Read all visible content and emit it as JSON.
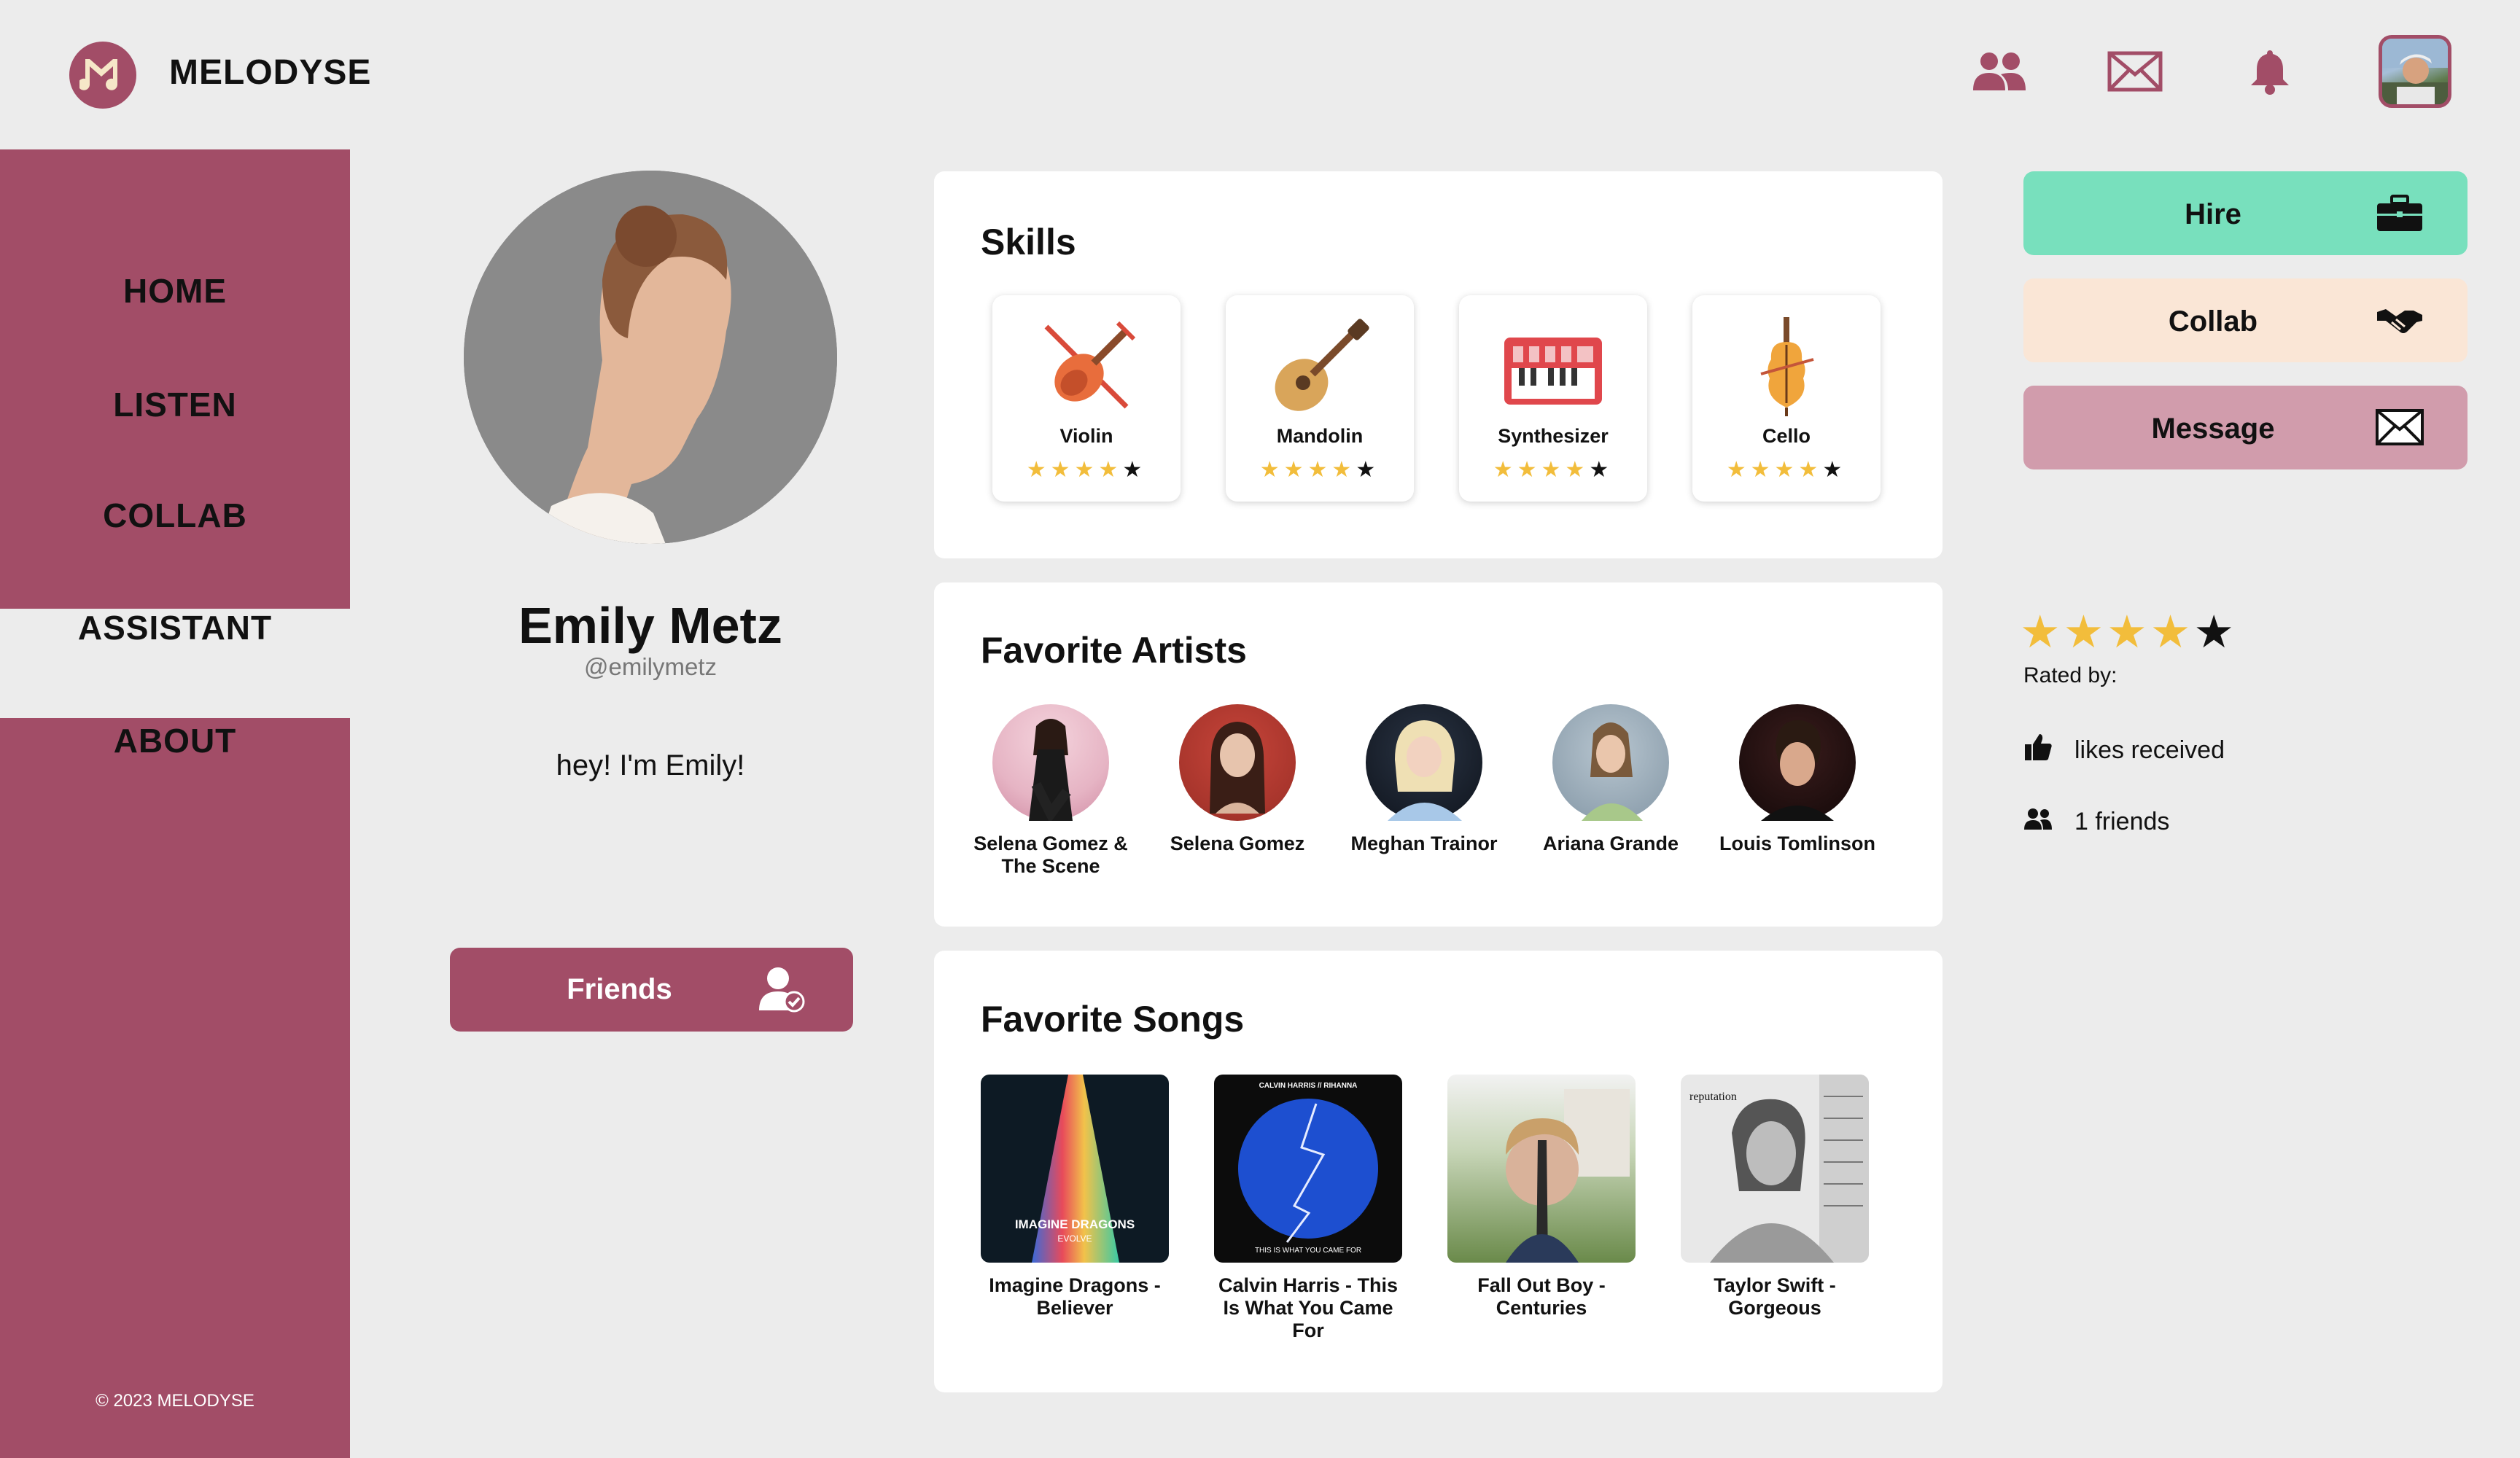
{
  "header": {
    "brand": "MELODYSE",
    "icons": [
      "friends-icon",
      "mail-icon",
      "bell-icon"
    ]
  },
  "sidebar": {
    "items": [
      {
        "label": "HOME"
      },
      {
        "label": "LISTEN"
      },
      {
        "label": "COLLAB"
      },
      {
        "label": "ASSISTANT"
      },
      {
        "label": "ABOUT"
      }
    ],
    "active": "COLLAB",
    "copyright": "© 2023 MELODYSE"
  },
  "profile": {
    "name": "Emily Metz",
    "handle": "@emilymetz",
    "bio": "hey! I'm Emily!",
    "friends_label": "Friends"
  },
  "skills": {
    "title": "Skills",
    "items": [
      {
        "name": "Violin",
        "rating": 4,
        "max": 5
      },
      {
        "name": "Mandolin",
        "rating": 4,
        "max": 5
      },
      {
        "name": "Synthesizer",
        "rating": 4,
        "max": 5
      },
      {
        "name": "Cello",
        "rating": 4,
        "max": 5
      }
    ]
  },
  "artists": {
    "title": "Favorite Artists",
    "items": [
      {
        "name": "Selena Gomez & The Scene"
      },
      {
        "name": "Selena Gomez"
      },
      {
        "name": "Meghan Trainor"
      },
      {
        "name": "Ariana Grande"
      },
      {
        "name": "Louis Tomlinson"
      }
    ]
  },
  "songs": {
    "title": "Favorite Songs",
    "items": [
      {
        "name": "Imagine Dragons - Believer",
        "cover_text": "IMAGINE DRAGONS",
        "cover_sub": "EVOLVE"
      },
      {
        "name": "Calvin Harris - This Is What You Came For",
        "cover_text": "CALVIN HARRIS // RIHANNA",
        "cover_sub": "THIS IS WHAT YOU CAME FOR"
      },
      {
        "name": "Fall Out Boy - Centuries",
        "cover_text": "",
        "cover_sub": ""
      },
      {
        "name": "Taylor Swift - Gorgeous",
        "cover_text": "reputation",
        "cover_sub": ""
      }
    ]
  },
  "actions": {
    "hire": "Hire",
    "collab": "Collab",
    "message": "Message"
  },
  "rating": {
    "stars": 4,
    "max": 5,
    "rated_by": "Rated by:",
    "likes": "likes received",
    "friends": "1 friends"
  },
  "colors": {
    "brand": "#a24d67",
    "background": "#ececec",
    "hire": "#78e0bd",
    "collab": "#fae6d6",
    "message": "#d19cac",
    "star": "#f2bd3b"
  }
}
